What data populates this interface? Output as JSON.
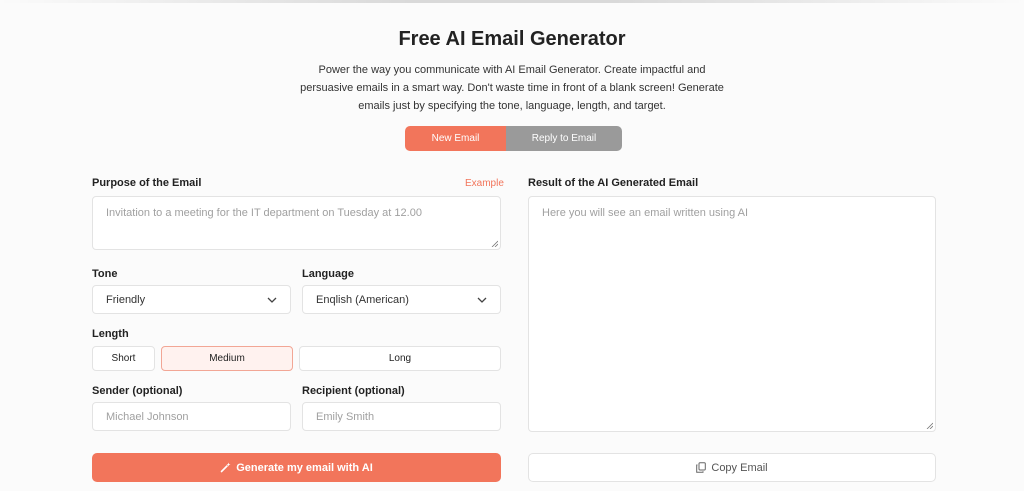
{
  "page": {
    "title": "Free AI Email Generator",
    "description": "Power the way you communicate with AI Email Generator. Create impactful and persuasive emails in a smart way. Don't waste time in front of a blank screen! Generate emails just by specifying the tone, language, length, and target."
  },
  "mode_tabs": [
    {
      "label": "New Email",
      "active": true
    },
    {
      "label": "Reply to Email",
      "active": false
    }
  ],
  "purpose": {
    "label": "Purpose of the Email",
    "example_link": "Example",
    "placeholder": "Invitation to a meeting for the IT department on Tuesday at 12.00"
  },
  "tone": {
    "label": "Tone",
    "value": "Friendly"
  },
  "language": {
    "label": "Language",
    "value": "Enqlish (American)"
  },
  "length": {
    "label": "Length",
    "options": [
      "Short",
      "Medium",
      "Long"
    ],
    "selected": "Medium"
  },
  "sender": {
    "label": "Sender (optional)",
    "placeholder": "Michael Johnson"
  },
  "recipient": {
    "label": "Recipient (optional)",
    "placeholder": "Emily Smith"
  },
  "generate_button": {
    "label": "Generate my email with AI",
    "icon": "magic-wand-icon"
  },
  "result": {
    "label": "Result of the AI Generated Email",
    "placeholder": "Here you will see an email written using AI"
  },
  "copy_button": {
    "label": "Copy Email",
    "icon": "copy-icon"
  },
  "colors": {
    "accent": "#f2755b",
    "inactive_tab": "#9a9a9a",
    "selected_length_bg": "#fff2ef"
  }
}
